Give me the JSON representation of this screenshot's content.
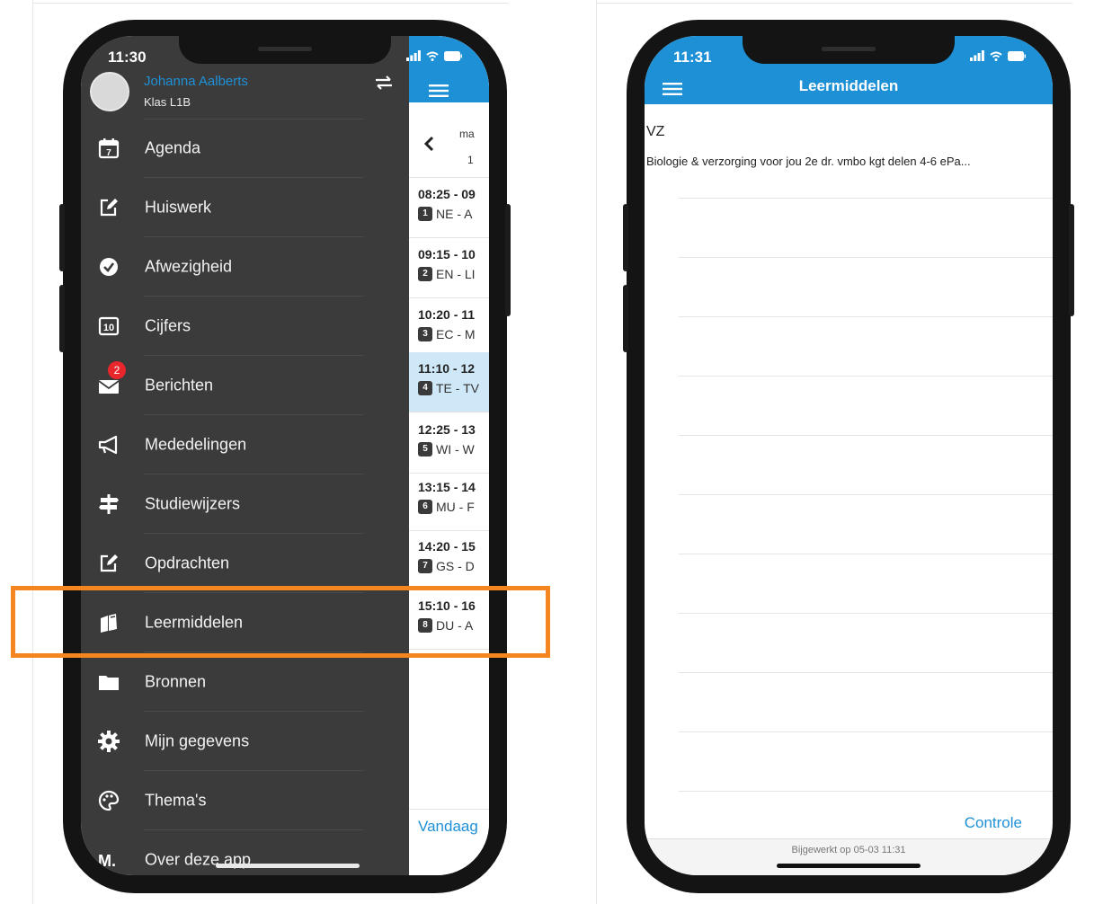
{
  "left_phone": {
    "status_time": "11:30",
    "user": {
      "name": "Johanna Aalberts",
      "class_label": "Klas L1B"
    },
    "menu": [
      {
        "label": "Agenda",
        "icon": "calendar-icon",
        "badge": ""
      },
      {
        "label": "Huiswerk",
        "icon": "edit-icon",
        "badge": ""
      },
      {
        "label": "Afwezigheid",
        "icon": "check-circle-icon",
        "badge": ""
      },
      {
        "label": "Cijfers",
        "icon": "grade-10-icon",
        "badge": ""
      },
      {
        "label": "Berichten",
        "icon": "mail-icon",
        "badge": "2"
      },
      {
        "label": "Mededelingen",
        "icon": "megaphone-icon",
        "badge": ""
      },
      {
        "label": "Studiewijzers",
        "icon": "signpost-icon",
        "badge": ""
      },
      {
        "label": "Opdrachten",
        "icon": "edit-icon",
        "badge": ""
      },
      {
        "label": "Leermiddelen",
        "icon": "books-icon",
        "badge": ""
      },
      {
        "label": "Bronnen",
        "icon": "folder-icon",
        "badge": ""
      },
      {
        "label": "Mijn gegevens",
        "icon": "gear-icon",
        "badge": ""
      },
      {
        "label": "Thema's",
        "icon": "palette-icon",
        "badge": ""
      },
      {
        "label": "Over deze app",
        "icon": "magister-logo-icon",
        "badge": ""
      }
    ],
    "agenda": {
      "day_label": "ma",
      "day_number": "1",
      "today_button": "Vandaag",
      "slots": [
        {
          "time": "08:25 - 09",
          "hour": "1",
          "subject": "NE - A"
        },
        {
          "time": "09:15 - 10",
          "hour": "2",
          "subject": "EN - LI"
        },
        {
          "time": "10:20 - 11",
          "hour": "3",
          "subject": "EC - M"
        },
        {
          "time": "11:10 - 12",
          "hour": "4",
          "subject": "TE - TV"
        },
        {
          "time": "12:25 - 13",
          "hour": "5",
          "subject": "WI - W"
        },
        {
          "time": "13:15 - 14",
          "hour": "6",
          "subject": "MU - F"
        },
        {
          "time": "14:20 - 15",
          "hour": "7",
          "subject": "GS - D"
        },
        {
          "time": "15:10 - 16",
          "hour": "8",
          "subject": "DU - A"
        }
      ]
    },
    "colors": {
      "drawer": "#3b3b3b",
      "accent": "#1e90d6",
      "highlight": "#f5861f",
      "current_slot": "#cfe8f7"
    }
  },
  "right_phone": {
    "status_time": "11:31",
    "title": "Leermiddelen",
    "item": {
      "code": "VZ",
      "description": "Biologie & verzorging voor jou 2e dr. vmbo kgt delen 4-6 ePa..."
    },
    "check_button": "Controle",
    "updated_text": "Bijgewerkt op 05-03 11:31"
  }
}
